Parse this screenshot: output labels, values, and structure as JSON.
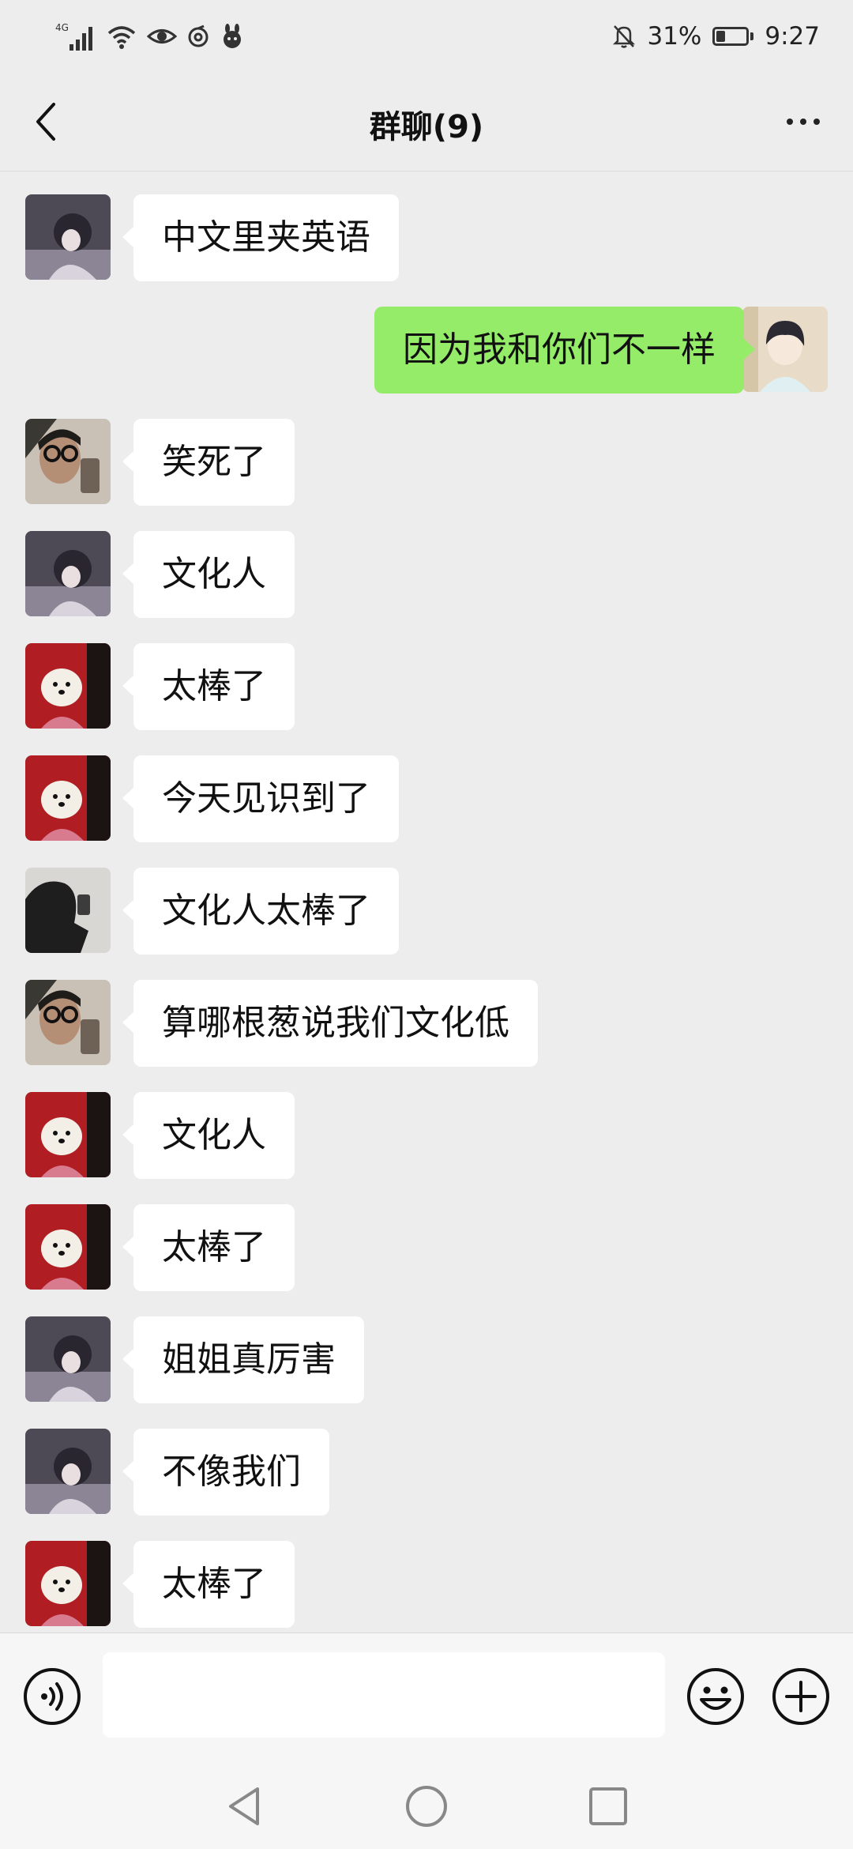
{
  "status_bar": {
    "network": "4G",
    "battery_percent": "31%",
    "battery_level": 0.31,
    "time": "9:27"
  },
  "header": {
    "title": "群聊(9)"
  },
  "messages": [
    {
      "side": "left",
      "avatar": "avatar-girl-anime",
      "text": "中文里夹英语"
    },
    {
      "side": "right",
      "avatar": "avatar-boy-anime",
      "text": "因为我和你们不一样"
    },
    {
      "side": "left",
      "avatar": "avatar-glasses-selfie",
      "text": "笑死了"
    },
    {
      "side": "left",
      "avatar": "avatar-girl-anime",
      "text": "文化人"
    },
    {
      "side": "left",
      "avatar": "avatar-dog-red",
      "text": "太棒了"
    },
    {
      "side": "left",
      "avatar": "avatar-dog-red",
      "text": "今天见识到了"
    },
    {
      "side": "left",
      "avatar": "avatar-dark-figure",
      "text": "文化人太棒了"
    },
    {
      "side": "left",
      "avatar": "avatar-glasses-selfie",
      "text": "算哪根葱说我们文化低"
    },
    {
      "side": "left",
      "avatar": "avatar-dog-red",
      "text": "文化人"
    },
    {
      "side": "left",
      "avatar": "avatar-dog-red",
      "text": "太棒了"
    },
    {
      "side": "left",
      "avatar": "avatar-girl-anime",
      "text": "姐姐真厉害"
    },
    {
      "side": "left",
      "avatar": "avatar-girl-anime",
      "text": "不像我们"
    },
    {
      "side": "left",
      "avatar": "avatar-dog-red",
      "text": "太棒了"
    }
  ],
  "input_bar": {
    "value": ""
  },
  "colors": {
    "background": "#ededed",
    "own_bubble": "#95ec69",
    "other_bubble": "#ffffff"
  }
}
